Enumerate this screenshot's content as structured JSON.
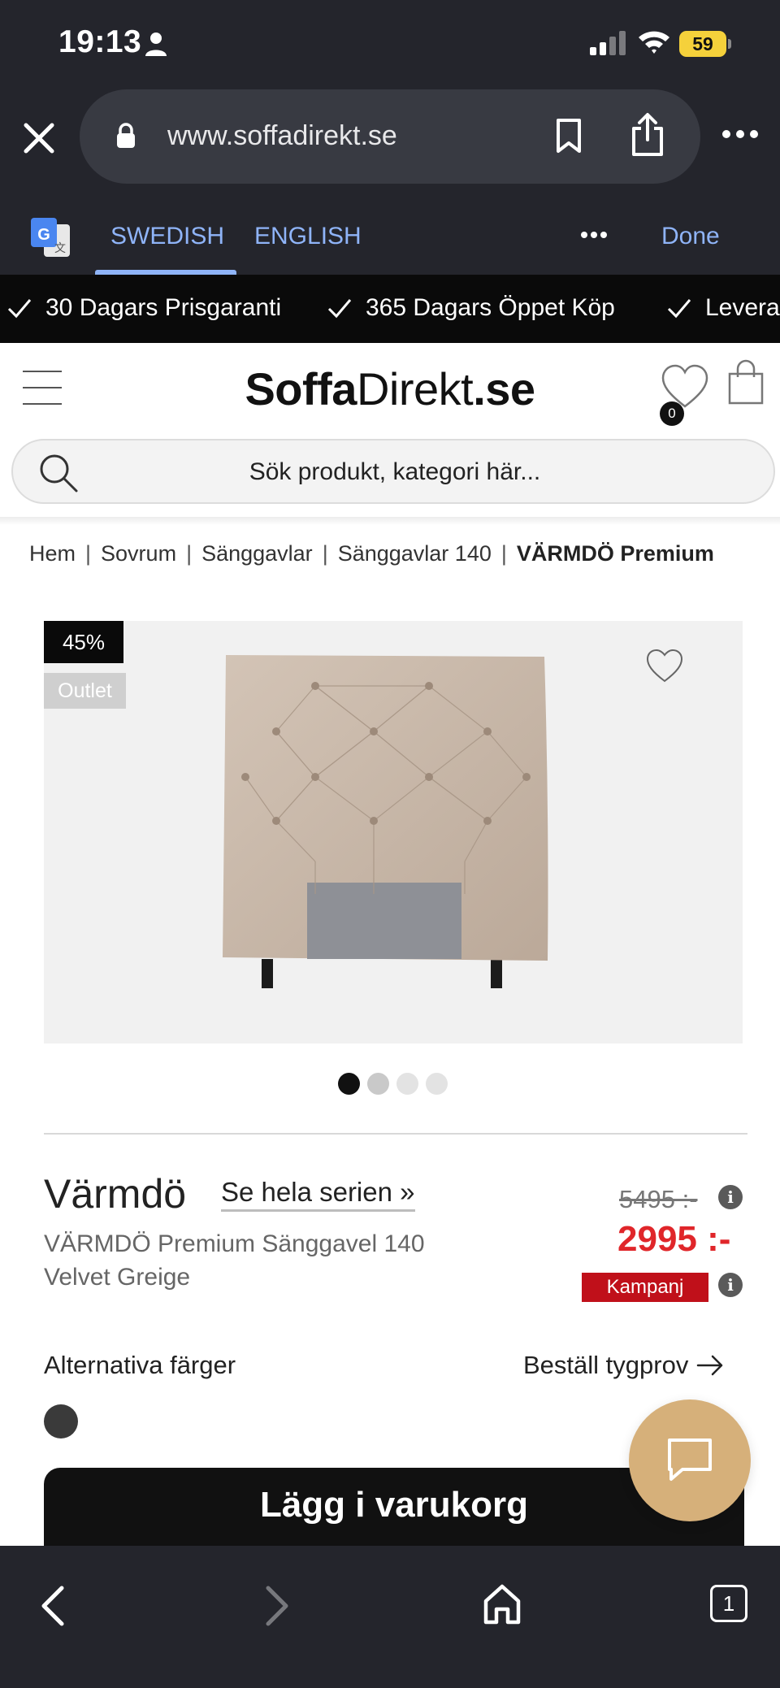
{
  "status_bar": {
    "time": "19:13",
    "battery": "59"
  },
  "browser": {
    "url": "www.soffadirekt.se"
  },
  "translate_bar": {
    "lang_source": "SWEDISH",
    "lang_target": "ENGLISH",
    "done_label": "Done"
  },
  "promo": {
    "items": [
      "30 Dagars Prisgaranti",
      "365 Dagars Öppet Köp",
      "Levera"
    ]
  },
  "header": {
    "logo_bold": "Soffa",
    "logo_light": "Direkt",
    "logo_suffix": ".se",
    "wishlist_count": "0"
  },
  "search": {
    "placeholder": "Sök produkt, kategori här..."
  },
  "breadcrumb": {
    "items": [
      "Hem",
      "Sovrum",
      "Sänggavlar",
      "Sänggavlar 140"
    ],
    "separator": "|",
    "current": "VÄRMDÖ Premium"
  },
  "product": {
    "discount_badge": "45%",
    "outlet_badge": "Outlet",
    "name": "Värmdö",
    "series_link": "Se hela serien »",
    "description": "VÄRMDÖ Premium Sänggavel 140 Velvet Greige",
    "old_price": "5495 :-",
    "price": "2995 :-",
    "campaign_badge": "Kampanj",
    "alt_colors_label": "Alternativa färger",
    "fabric_sample_label": "Beställ tygprov",
    "add_to_cart_label": "Lägg i varukorg",
    "carousel_active_index": 1,
    "carousel_total": 4
  },
  "bottom_nav": {
    "tab_count": "1"
  },
  "colors": {
    "price_red": "#e0262a",
    "campaign_red": "#c0101a",
    "chat_gold": "#d6b07a",
    "translate_blue": "#8fb4f8"
  },
  "icons": [
    "person-icon",
    "signal-icon",
    "wifi-icon",
    "close-icon",
    "lock-icon",
    "bookmark-icon",
    "share-icon",
    "more-icon",
    "google-translate-icon",
    "check-icon",
    "menu-icon",
    "heart-icon",
    "cart-icon",
    "search-icon",
    "info-icon",
    "arrow-right-icon",
    "chat-icon",
    "back-icon",
    "forward-icon",
    "home-icon"
  ]
}
